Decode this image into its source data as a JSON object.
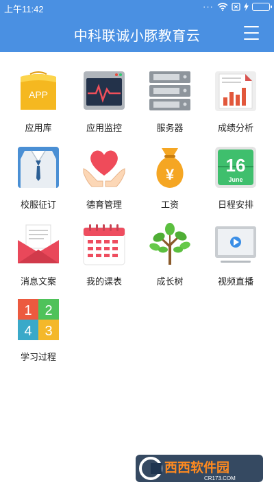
{
  "status_bar": {
    "time": "上午11:42",
    "icons": [
      "more-dots-icon",
      "wifi-icon",
      "sim-off-icon",
      "charging-icon",
      "battery-icon"
    ]
  },
  "header": {
    "title": "中科联诚小豚教育云",
    "menu_icon": "hamburger-menu-icon",
    "background": "#4a90e2"
  },
  "apps": [
    {
      "label": "应用库",
      "icon": "app-bag-icon"
    },
    {
      "label": "应用监控",
      "icon": "monitor-icon"
    },
    {
      "label": "服务器",
      "icon": "server-icon"
    },
    {
      "label": "成绩分析",
      "icon": "bar-chart-icon"
    },
    {
      "label": "校服征订",
      "icon": "uniform-icon"
    },
    {
      "label": "德育管理",
      "icon": "heart-hands-icon"
    },
    {
      "label": "工资",
      "icon": "money-bag-icon"
    },
    {
      "label": "日程安排",
      "icon": "calendar-date-icon",
      "badge_day": "16",
      "badge_month": "June"
    },
    {
      "label": "消息文案",
      "icon": "envelope-icon"
    },
    {
      "label": "我的课表",
      "icon": "schedule-icon"
    },
    {
      "label": "成长树",
      "icon": "tree-icon"
    },
    {
      "label": "视频直播",
      "icon": "video-icon"
    },
    {
      "label": "学习过程",
      "icon": "numbers-grid-icon",
      "digits": [
        "1",
        "2",
        "4",
        "3"
      ]
    }
  ],
  "app_store_label": "APP",
  "money_symbol": "¥",
  "watermark": {
    "main": "西西软件园",
    "sub": "CR173.COM"
  }
}
